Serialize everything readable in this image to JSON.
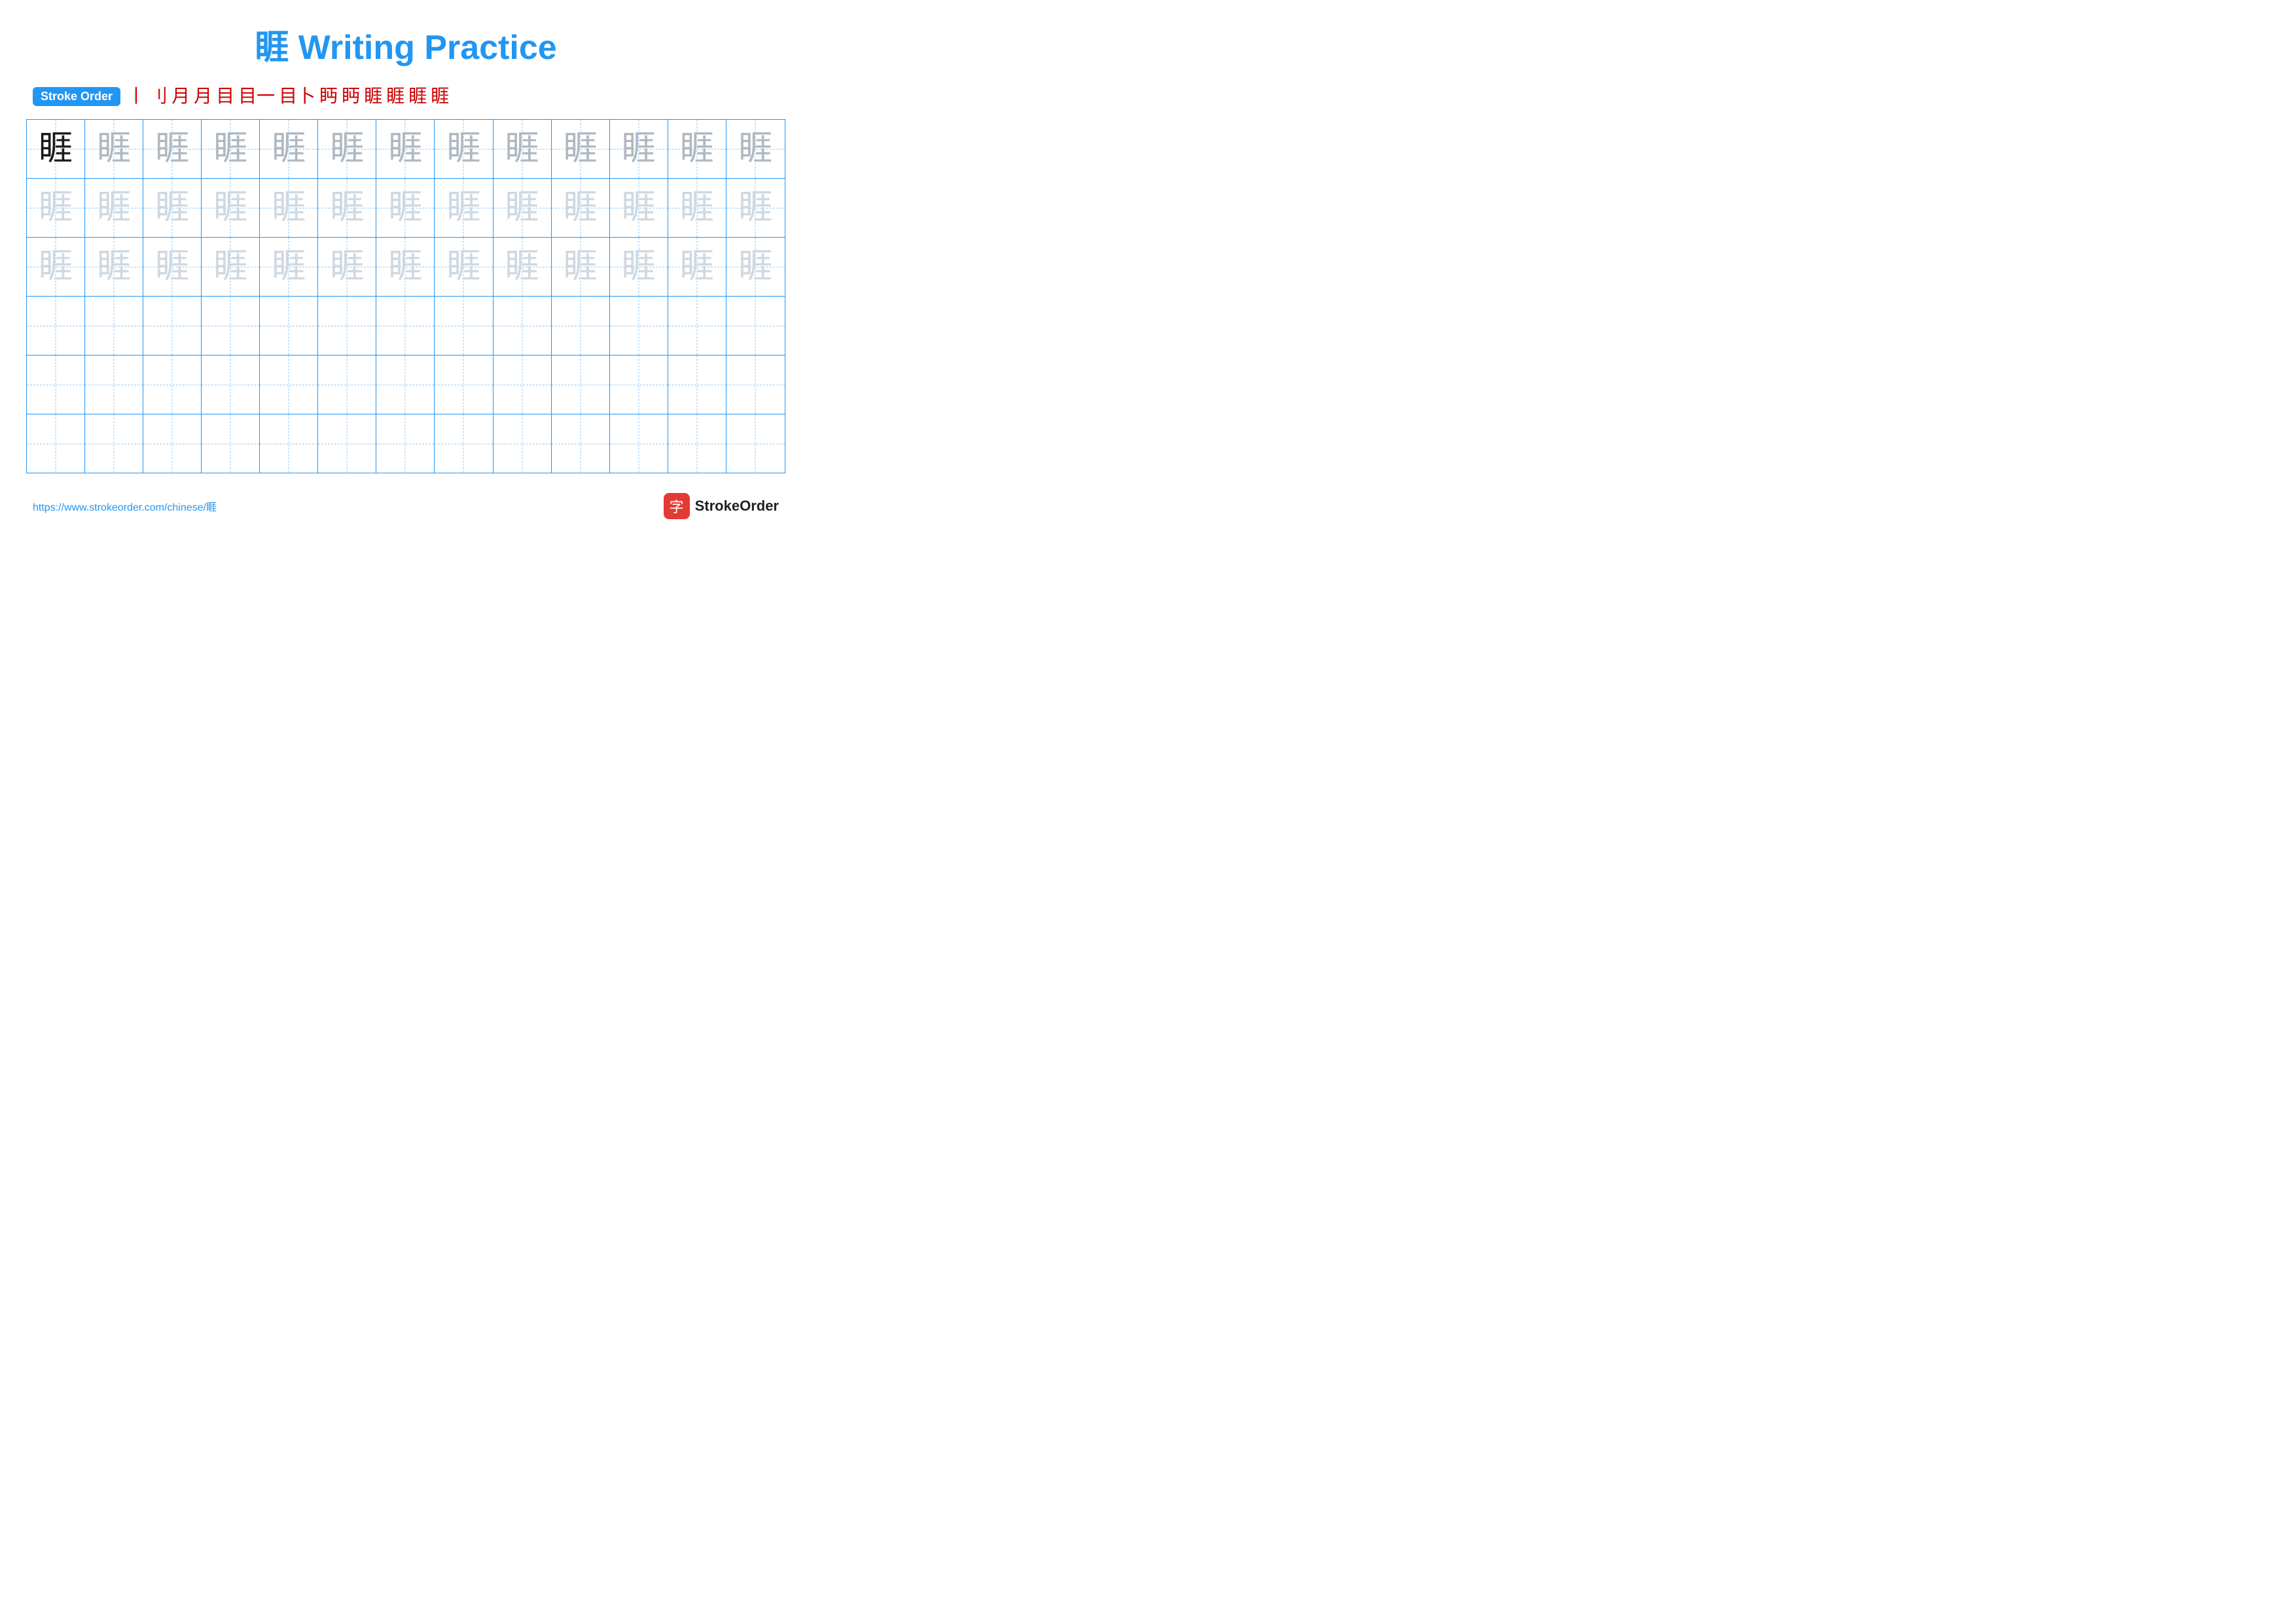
{
  "title": "睚 Writing Practice",
  "stroke_order": {
    "badge": "Stroke Order",
    "chars": [
      "丨",
      "刂",
      "月",
      "月",
      "目",
      "目一",
      "目卜",
      "眄",
      "眄",
      "睚",
      "睚",
      "睚",
      "睚"
    ]
  },
  "character": "睚",
  "rows": [
    {
      "id": "row1",
      "cells": [
        {
          "style": "dark",
          "char": "睚"
        },
        {
          "style": "medium",
          "char": "睚"
        },
        {
          "style": "medium",
          "char": "睚"
        },
        {
          "style": "medium",
          "char": "睚"
        },
        {
          "style": "medium",
          "char": "睚"
        },
        {
          "style": "medium",
          "char": "睚"
        },
        {
          "style": "medium",
          "char": "睚"
        },
        {
          "style": "medium",
          "char": "睚"
        },
        {
          "style": "medium",
          "char": "睚"
        },
        {
          "style": "medium",
          "char": "睚"
        },
        {
          "style": "medium",
          "char": "睚"
        },
        {
          "style": "medium",
          "char": "睚"
        },
        {
          "style": "medium",
          "char": "睚"
        }
      ]
    },
    {
      "id": "row2",
      "cells": [
        {
          "style": "light",
          "char": "睚"
        },
        {
          "style": "light",
          "char": "睚"
        },
        {
          "style": "light",
          "char": "睚"
        },
        {
          "style": "light",
          "char": "睚"
        },
        {
          "style": "light",
          "char": "睚"
        },
        {
          "style": "light",
          "char": "睚"
        },
        {
          "style": "light",
          "char": "睚"
        },
        {
          "style": "light",
          "char": "睚"
        },
        {
          "style": "light",
          "char": "睚"
        },
        {
          "style": "light",
          "char": "睚"
        },
        {
          "style": "light",
          "char": "睚"
        },
        {
          "style": "light",
          "char": "睚"
        },
        {
          "style": "light",
          "char": "睚"
        }
      ]
    },
    {
      "id": "row3",
      "cells": [
        {
          "style": "light",
          "char": "睚"
        },
        {
          "style": "light",
          "char": "睚"
        },
        {
          "style": "light",
          "char": "睚"
        },
        {
          "style": "light",
          "char": "睚"
        },
        {
          "style": "light",
          "char": "睚"
        },
        {
          "style": "light",
          "char": "睚"
        },
        {
          "style": "light",
          "char": "睚"
        },
        {
          "style": "light",
          "char": "睚"
        },
        {
          "style": "light",
          "char": "睚"
        },
        {
          "style": "light",
          "char": "睚"
        },
        {
          "style": "light",
          "char": "睚"
        },
        {
          "style": "light",
          "char": "睚"
        },
        {
          "style": "light",
          "char": "睚"
        }
      ]
    },
    {
      "id": "row4",
      "cells": [
        {
          "style": "empty"
        },
        {
          "style": "empty"
        },
        {
          "style": "empty"
        },
        {
          "style": "empty"
        },
        {
          "style": "empty"
        },
        {
          "style": "empty"
        },
        {
          "style": "empty"
        },
        {
          "style": "empty"
        },
        {
          "style": "empty"
        },
        {
          "style": "empty"
        },
        {
          "style": "empty"
        },
        {
          "style": "empty"
        },
        {
          "style": "empty"
        }
      ]
    },
    {
      "id": "row5",
      "cells": [
        {
          "style": "empty"
        },
        {
          "style": "empty"
        },
        {
          "style": "empty"
        },
        {
          "style": "empty"
        },
        {
          "style": "empty"
        },
        {
          "style": "empty"
        },
        {
          "style": "empty"
        },
        {
          "style": "empty"
        },
        {
          "style": "empty"
        },
        {
          "style": "empty"
        },
        {
          "style": "empty"
        },
        {
          "style": "empty"
        },
        {
          "style": "empty"
        }
      ]
    },
    {
      "id": "row6",
      "cells": [
        {
          "style": "empty"
        },
        {
          "style": "empty"
        },
        {
          "style": "empty"
        },
        {
          "style": "empty"
        },
        {
          "style": "empty"
        },
        {
          "style": "empty"
        },
        {
          "style": "empty"
        },
        {
          "style": "empty"
        },
        {
          "style": "empty"
        },
        {
          "style": "empty"
        },
        {
          "style": "empty"
        },
        {
          "style": "empty"
        },
        {
          "style": "empty"
        }
      ]
    }
  ],
  "footer": {
    "url": "https://www.strokeorder.com/chinese/睚",
    "brand_icon": "字",
    "brand_name": "StrokeOrder"
  }
}
